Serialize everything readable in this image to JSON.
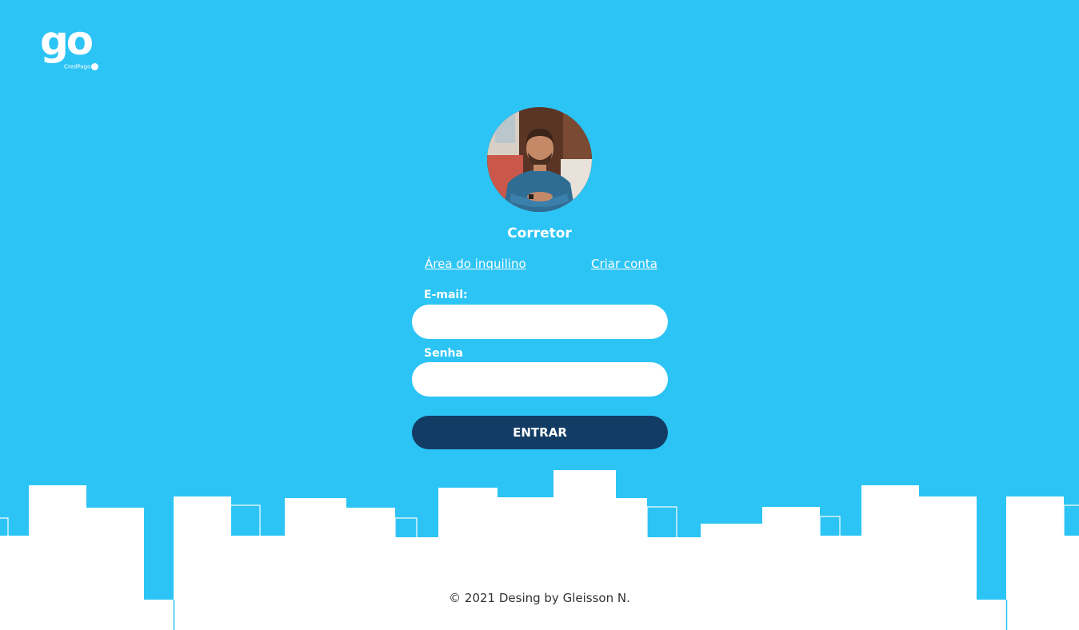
{
  "header": {
    "logo_text": "go",
    "logo_subtext": "CredPago"
  },
  "login": {
    "role_title": "Corretor",
    "link_tenant": "Área do inquilino",
    "link_create": "Criar conta",
    "email_label": "E-mail:",
    "email_value": "",
    "password_label": "Senha",
    "password_value": "",
    "submit_label": "ENTRAR"
  },
  "footer": {
    "copyright": "© 2021 Desing by Gleisson N."
  },
  "colors": {
    "background": "#2cc4f5",
    "button": "#123c64",
    "white": "#ffffff"
  }
}
